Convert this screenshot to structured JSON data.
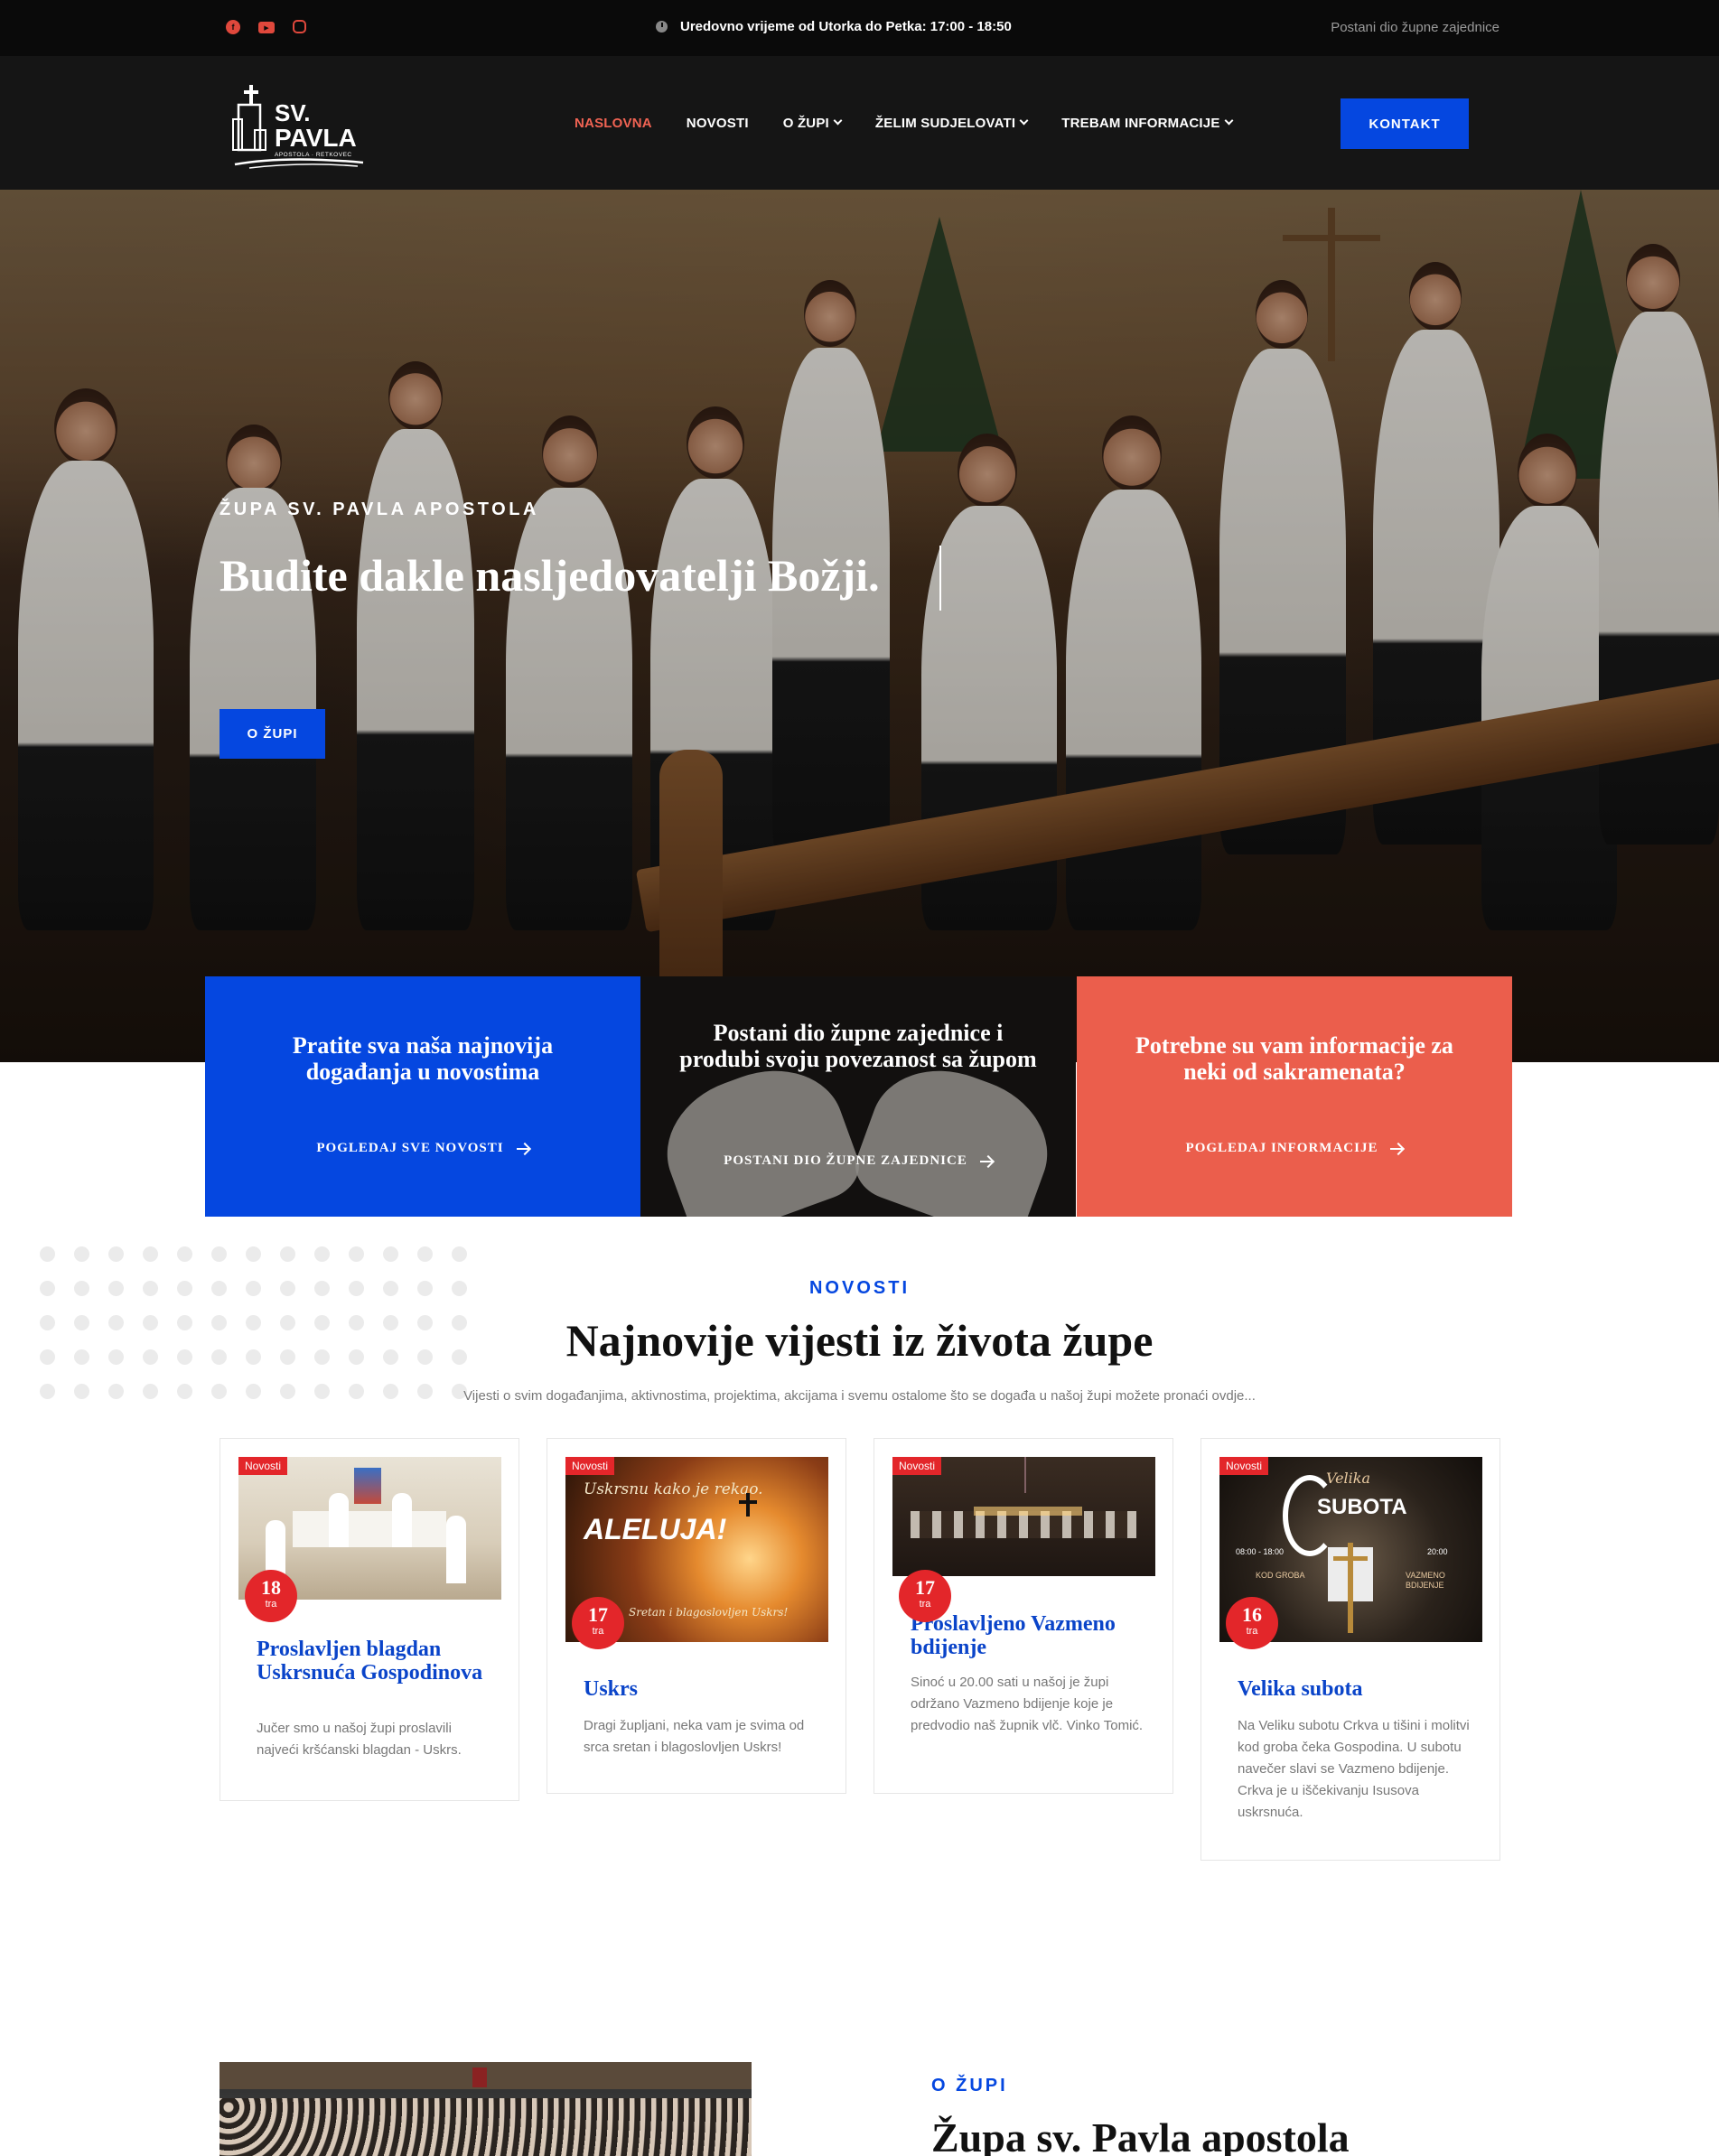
{
  "topbar": {
    "socials": [
      {
        "name": "facebook",
        "icon": "facebook-icon",
        "glyph": "f"
      },
      {
        "name": "youtube",
        "icon": "youtube-icon",
        "glyph": "▶"
      },
      {
        "name": "instagram",
        "icon": "instagram-icon",
        "glyph": ""
      }
    ],
    "hours": "Uredovno vrijeme od Utorka do Petka: 17:00 - 18:50",
    "join_link": "Postani dio župne zajednice"
  },
  "header": {
    "logo": {
      "line1": "SV.",
      "line2": "PAVLA",
      "line3": "APOSTOLA · RETKOVEC"
    },
    "nav": [
      {
        "label": "NASLOVNA",
        "active": true,
        "dropdown": false
      },
      {
        "label": "NOVOSTI",
        "active": false,
        "dropdown": false
      },
      {
        "label": "O ŽUPI",
        "active": false,
        "dropdown": true
      },
      {
        "label": "ŽELIM SUDJELOVATI",
        "active": false,
        "dropdown": true
      },
      {
        "label": "TREBAM INFORMACIJE",
        "active": false,
        "dropdown": true
      }
    ],
    "contact_button": "KONTAKT"
  },
  "hero": {
    "kicker": "ŽUPA SV. PAVLA APOSTOLA",
    "title": "Budite dakle nasljedovatelji Božji.",
    "button": "O ŽUPI"
  },
  "features": [
    {
      "title": "Pratite sva naša najnovija događanja u novostima",
      "link": "POGLEDAJ SVE NOVOSTI"
    },
    {
      "title": "Postani dio župne zajednice i produbi svoju povezanost sa župom",
      "link": "POSTANI DIO ŽUPNE ZAJEDNICE"
    },
    {
      "title": "Potrebne su vam informacije za neki od sakramenata?",
      "link": "POGLEDAJ INFORMACIJE"
    }
  ],
  "news": {
    "kicker": "NOVOSTI",
    "title": "Najnovije vijesti iz života župe",
    "subtitle": "Vijesti o svim događanjima, aktivnostima, projektima, akcijama i svemu ostalome što se događa u našoj župi možete pronaći ovdje...",
    "cards": [
      {
        "tag": "Novosti",
        "day": "18",
        "month": "tra",
        "title": "Proslavljen blagdan Uskrsnuća Gospodinova",
        "text": "Jučer smo u našoj župi proslavili najveći kršćanski blagdan - Uskrs."
      },
      {
        "tag": "Novosti",
        "day": "17",
        "month": "tra",
        "title": "Uskrs",
        "text": "Dragi župljani, neka vam je svima od srca sretan i blagoslovljen Uskrs!",
        "image_text": {
          "line1": "Uskrsnu kako je rekao.",
          "line2": "ALELUJA!",
          "line3": "Sretan i blagoslovljen Uskrs!"
        }
      },
      {
        "tag": "Novosti",
        "day": "17",
        "month": "tra",
        "title": "Proslavljeno Vazmeno bdijenje",
        "text": "Sinoć u 20.00 sati u našoj je župi održano Vazmeno bdijenje koje je predvodio naš župnik vlč. Vinko Tomić."
      },
      {
        "tag": "Novosti",
        "day": "16",
        "month": "tra",
        "title": "Velika subota",
        "text": "Na Veliku subotu Crkva u tišini i molitvi kod groba čeka Gospodina. U subotu navečer slavi se Vazmeno bdijenje. Crkva je u iščekivanju Isusova uskrsnuća.",
        "image_text": {
          "line1": "Velika",
          "line2": "SUBOTA",
          "time1": "08:00 - 18:00",
          "label1": "KOD GROBA",
          "time2": "20:00",
          "label2": "VAZMENO BDIJENJE"
        }
      }
    ]
  },
  "about": {
    "kicker": "O ŽUPI",
    "title": "Župa sv. Pavla apostola"
  },
  "colors": {
    "accent_blue": "#0547e0",
    "link_blue": "#0a44c9",
    "coral": "#eb5e4c",
    "badge_red": "#e3262a",
    "nav_active": "#f06353",
    "dark_bg": "#151515"
  }
}
